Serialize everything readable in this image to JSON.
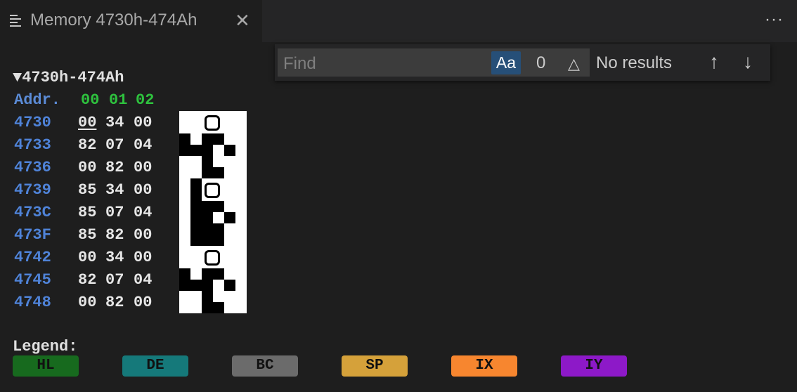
{
  "tab": {
    "title": "Memory 4730h-474Ah",
    "close_glyph": "✕",
    "icon": "lines-icon"
  },
  "toolbar": {
    "more_glyph": "···"
  },
  "find": {
    "placeholder": "Find",
    "match_case_label": "Aa",
    "count": "0",
    "delta_glyph": "△",
    "results": "No results",
    "prev_glyph": "↑",
    "next_glyph": "↓"
  },
  "memory": {
    "range_label": "▼4730h-474Ah",
    "header": {
      "addr": "Addr.",
      "cols": [
        "00",
        "01",
        "02"
      ]
    },
    "rows": [
      {
        "addr": "4730",
        "bytes": [
          "00",
          "34",
          "00"
        ]
      },
      {
        "addr": "4733",
        "bytes": [
          "82",
          "07",
          "04"
        ]
      },
      {
        "addr": "4736",
        "bytes": [
          "00",
          "82",
          "00"
        ]
      },
      {
        "addr": "4739",
        "bytes": [
          "85",
          "34",
          "00"
        ]
      },
      {
        "addr": "473C",
        "bytes": [
          "85",
          "07",
          "04"
        ]
      },
      {
        "addr": "473F",
        "bytes": [
          "85",
          "82",
          "00"
        ]
      },
      {
        "addr": "4742",
        "bytes": [
          "00",
          "34",
          "00"
        ]
      },
      {
        "addr": "4745",
        "bytes": [
          "82",
          "07",
          "04"
        ]
      },
      {
        "addr": "4748",
        "bytes": [
          "00",
          "82",
          "00"
        ]
      }
    ]
  },
  "legend": {
    "label": "Legend:",
    "items": [
      {
        "name": "HL",
        "color": "#176a1e"
      },
      {
        "name": "DE",
        "color": "#15797a"
      },
      {
        "name": "BC",
        "color": "#6b6b6b"
      },
      {
        "name": "SP",
        "color": "#d5a13a"
      },
      {
        "name": "IX",
        "color": "#f7862f"
      },
      {
        "name": "IY",
        "color": "#8d19c8"
      }
    ]
  },
  "colors": {
    "background": "#1e1e1e",
    "address": "#4f83d8",
    "column_header": "#2ec23e",
    "find_selected": "#264f78"
  }
}
